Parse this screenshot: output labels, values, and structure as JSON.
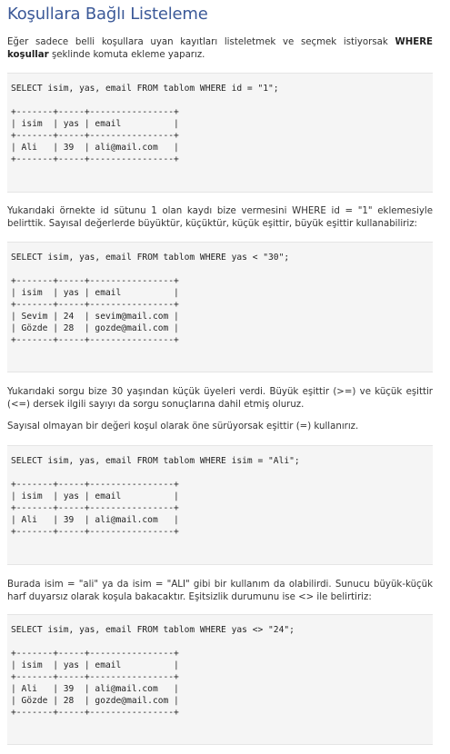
{
  "title": "Koşullara Bağlı Listeleme",
  "intro": {
    "text_before": "Eğer sadece belli koşullara uyan kayıtları listeletmek ve seçmek istiyorsak ",
    "bold": "WHERE koşullar",
    "text_after": " şeklinde komuta ekleme yaparız."
  },
  "blocks": [
    {
      "query": "SELECT isim, yas, email FROM tablom WHERE id = \"1\";",
      "table": "+-------+-----+----------------+\n| isim  | yas | email          |\n+-------+-----+----------------+\n| Ali   | 39  | ali@mail.com   |\n+-------+-----+----------------+"
    },
    {
      "query": "SELECT isim, yas, email FROM tablom WHERE yas < \"30\";",
      "table": "+-------+-----+----------------+\n| isim  | yas | email          |\n+-------+-----+----------------+\n| Sevim | 24  | sevim@mail.com |\n| Gözde | 28  | gozde@mail.com |\n+-------+-----+----------------+"
    },
    {
      "query": "SELECT isim, yas, email FROM tablom WHERE isim = \"Ali\";",
      "table": "+-------+-----+----------------+\n| isim  | yas | email          |\n+-------+-----+----------------+\n| Ali   | 39  | ali@mail.com   |\n+-------+-----+----------------+"
    },
    {
      "query": "SELECT isim, yas, email FROM tablom WHERE yas <> \"24\";",
      "table": "+-------+-----+----------------+\n| isim  | yas | email          |\n+-------+-----+----------------+\n| Ali   | 39  | ali@mail.com   |\n| Gözde | 28  | gozde@mail.com |\n+-------+-----+----------------+"
    }
  ],
  "paragraphs": {
    "p1": "Yukarıdaki örnekte id sütunu 1 olan kaydı bize vermesini WHERE id = \"1\" eklemesiyle belirttik. Sayısal değerlerde büyüktür, küçüktür, küçük eşittir, büyük eşittir kullanabiliriz:",
    "p2": "Yukarıdaki sorgu bize 30 yaşından küçük üyeleri verdi. Büyük eşittir (>=) ve küçük eşittir (<=) dersek ilgili sayıyı da sorgu sonuçlarına dahil etmiş oluruz.",
    "p3": "Sayısal olmayan bir değeri koşul olarak öne sürüyorsak eşittir (=) kullanırız.",
    "p4": "Burada isim = \"ali\" ya da isim = \"ALI\" gibi bir kullanım da olabilirdi. Sunucu büyük-küçük harf duyarsız olarak koşula bakacaktır. Eşitsizlik durumunu ise <> ile belirtiriz:"
  }
}
